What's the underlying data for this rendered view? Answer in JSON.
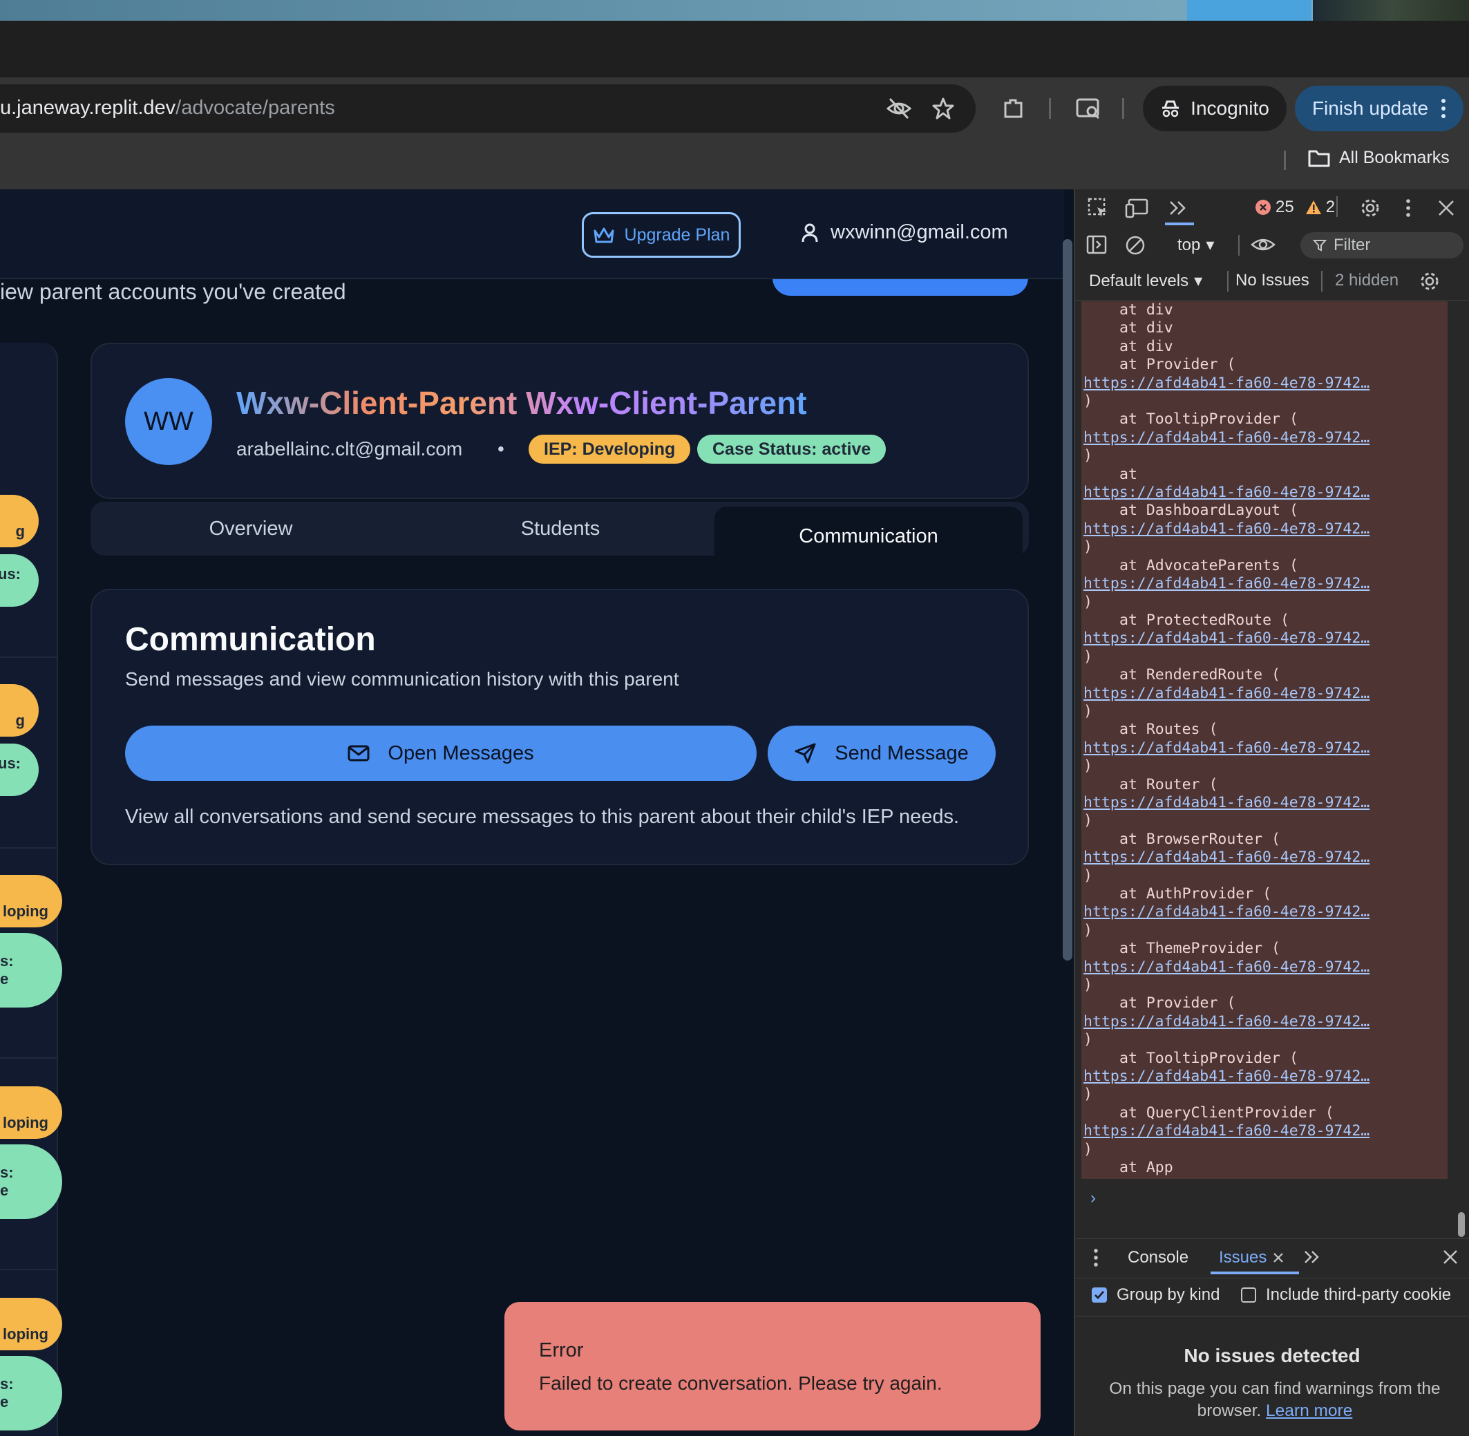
{
  "browser": {
    "url_host": "u.janeway.replit.dev",
    "url_path": "/advocate/parents",
    "incognito_label": "Incognito",
    "finish_update_label": "Finish update",
    "all_bookmarks_label": "All Bookmarks"
  },
  "header": {
    "upgrade_label": "Upgrade Plan",
    "user_email": "wxwinn@gmail.com"
  },
  "page": {
    "subtitle": "iew parent accounts you've created"
  },
  "left_list": {
    "badges": [
      "g",
      "us:",
      "g",
      "us:",
      "loping",
      "s:",
      "e",
      "loping",
      "s:",
      "e",
      "loping",
      "s:",
      "e"
    ]
  },
  "profile": {
    "initials": "WW",
    "name": "Wxw-Client-Parent Wxw-Client-Parent",
    "email": "arabellainc.clt@gmail.com",
    "separator": "•",
    "iep_badge": "IEP: Developing",
    "case_badge": "Case Status: active"
  },
  "tabs": {
    "overview": "Overview",
    "students": "Students",
    "communication": "Communication"
  },
  "communication": {
    "title": "Communication",
    "description": "Send messages and view communication history with this parent",
    "open_messages": "Open Messages",
    "send_message": "Send Message",
    "note": "View all conversations and send secure messages to this parent about their child's IEP needs."
  },
  "toast": {
    "title": "Error",
    "message": "Failed to create conversation. Please try again."
  },
  "devtools": {
    "error_count": "25",
    "warning_count": "2",
    "context": "top",
    "filter_placeholder": "Filter",
    "levels": "Default levels",
    "issues": "No Issues",
    "hidden": "2 hidden",
    "stack_url": "https://afd4ab41-fa60-4e78-9742…",
    "stack": [
      {
        "at": "at div"
      },
      {
        "at": "at div"
      },
      {
        "at": "at div"
      },
      {
        "at": "at Provider (",
        "url": true
      },
      {
        "at": "at TooltipProvider (",
        "url": true
      },
      {
        "at": "at",
        "url": true,
        "noclose": true
      },
      {
        "at": "at DashboardLayout (",
        "url": true
      },
      {
        "at": "at AdvocateParents (",
        "url": true
      },
      {
        "at": "at ProtectedRoute (",
        "url": true
      },
      {
        "at": "at RenderedRoute (",
        "url": true
      },
      {
        "at": "at Routes (",
        "url": true
      },
      {
        "at": "at Router (",
        "url": true
      },
      {
        "at": "at BrowserRouter (",
        "url": true
      },
      {
        "at": "at AuthProvider (",
        "url": true
      },
      {
        "at": "at ThemeProvider (",
        "url": true
      },
      {
        "at": "at Provider (",
        "url": true
      },
      {
        "at": "at TooltipProvider (",
        "url": true
      },
      {
        "at": "at QueryClientProvider (",
        "url": true
      },
      {
        "at": "at App"
      }
    ],
    "drawer": {
      "console_tab": "Console",
      "issues_tab": "Issues",
      "group_by_kind": "Group by kind",
      "third_party": "Include third-party cookie",
      "no_issues_title": "No issues detected",
      "no_issues_desc": "On this page you can find warnings from the browser.",
      "learn_more": "Learn more"
    }
  }
}
